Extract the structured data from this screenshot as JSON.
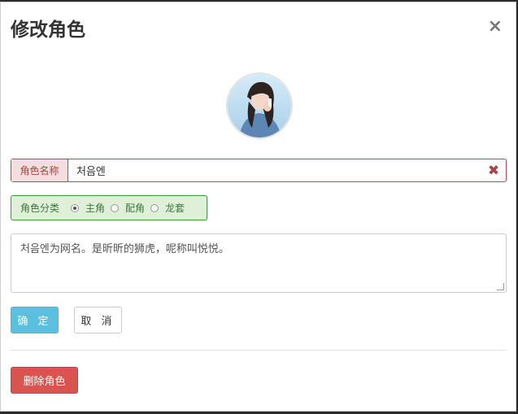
{
  "modal": {
    "title": "修改角色",
    "close_symbol": "×"
  },
  "role_name": {
    "label": "角色名称",
    "value": "처음엔",
    "clear_symbol": "✖"
  },
  "role_type": {
    "label": "角色分类",
    "options": [
      {
        "label": "主角",
        "selected": true
      },
      {
        "label": "配角",
        "selected": false
      },
      {
        "label": "龙套",
        "selected": false
      }
    ]
  },
  "description": {
    "value": "처음엔为网名。是昕昕的狮虎，呢称叫悦悦。"
  },
  "buttons": {
    "confirm": "确 定",
    "cancel": "取 消",
    "delete": "删除角色"
  },
  "colors": {
    "error": "#a94442",
    "success": "#3c763d",
    "info_button": "#5bc0de",
    "danger_button": "#d9534f"
  }
}
